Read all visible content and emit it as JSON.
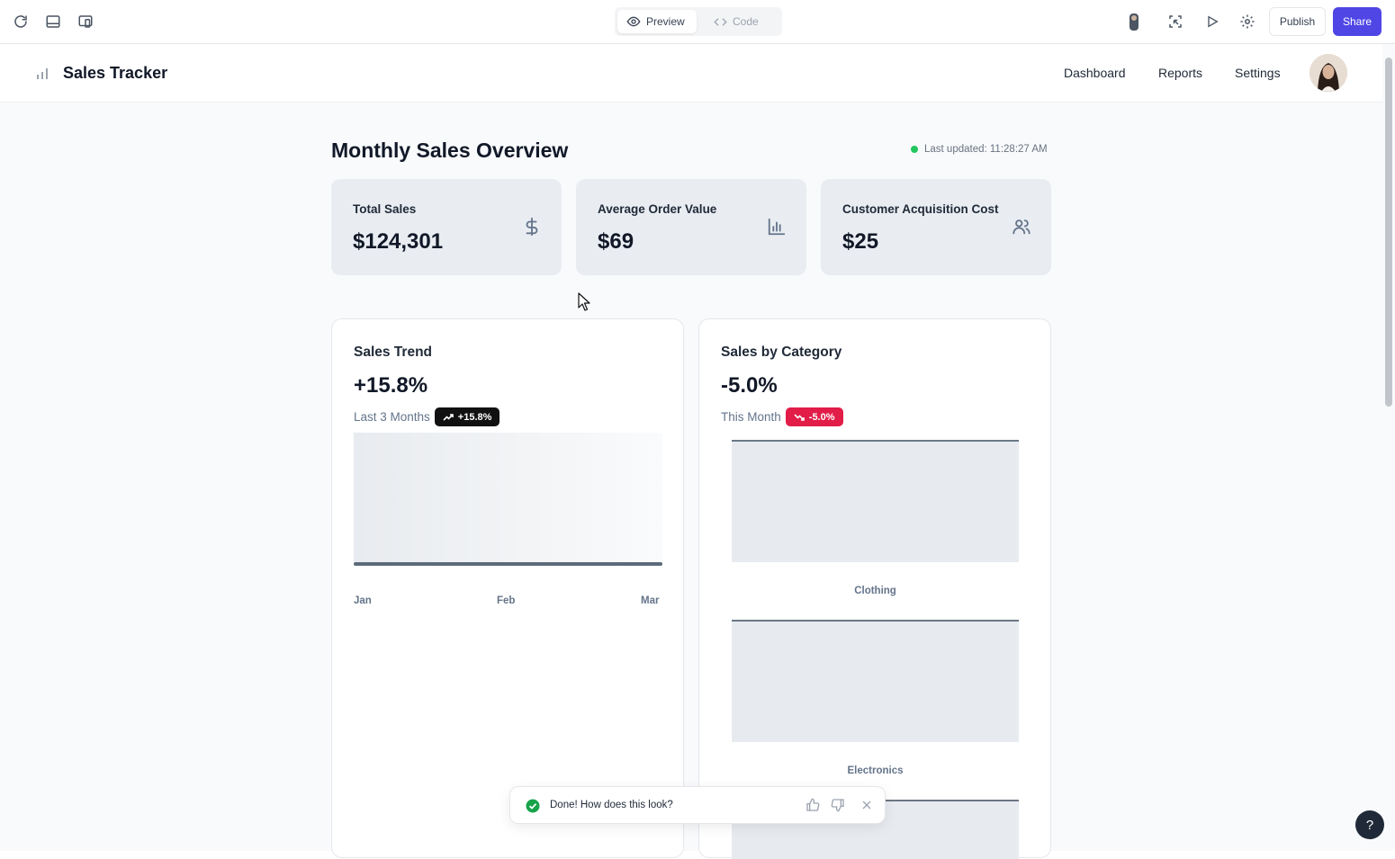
{
  "editor": {
    "preview_label": "Preview",
    "code_label": "Code",
    "publish_label": "Publish",
    "share_label": "Share"
  },
  "app": {
    "title": "Sales Tracker",
    "nav": [
      "Dashboard",
      "Reports",
      "Settings"
    ]
  },
  "page": {
    "title": "Monthly Sales Overview",
    "last_updated": "Last updated: 11:28:27 AM"
  },
  "stats": [
    {
      "label": "Total Sales",
      "value": "$124,301",
      "icon": "dollar-icon"
    },
    {
      "label": "Average Order Value",
      "value": "$69",
      "icon": "bar-chart-icon"
    },
    {
      "label": "Customer Acquisition Cost",
      "value": "$25",
      "icon": "users-icon"
    }
  ],
  "trend_card": {
    "title": "Sales Trend",
    "change": "+15.8%",
    "period": "Last 3 Months",
    "badge": "+15.8%",
    "ticks": [
      "Jan",
      "Feb",
      "Mar"
    ]
  },
  "category_card": {
    "title": "Sales by Category",
    "change": "-5.0%",
    "period": "This Month",
    "badge": "-5.0%",
    "categories": [
      "Clothing",
      "Electronics"
    ]
  },
  "toast": {
    "message": "Done! How does this look?"
  },
  "help": {
    "label": "?"
  },
  "colors": {
    "accent": "#4f46e5",
    "positive_badge": "#111111",
    "negative_badge": "#e11d48",
    "status_dot": "#22c55e"
  }
}
